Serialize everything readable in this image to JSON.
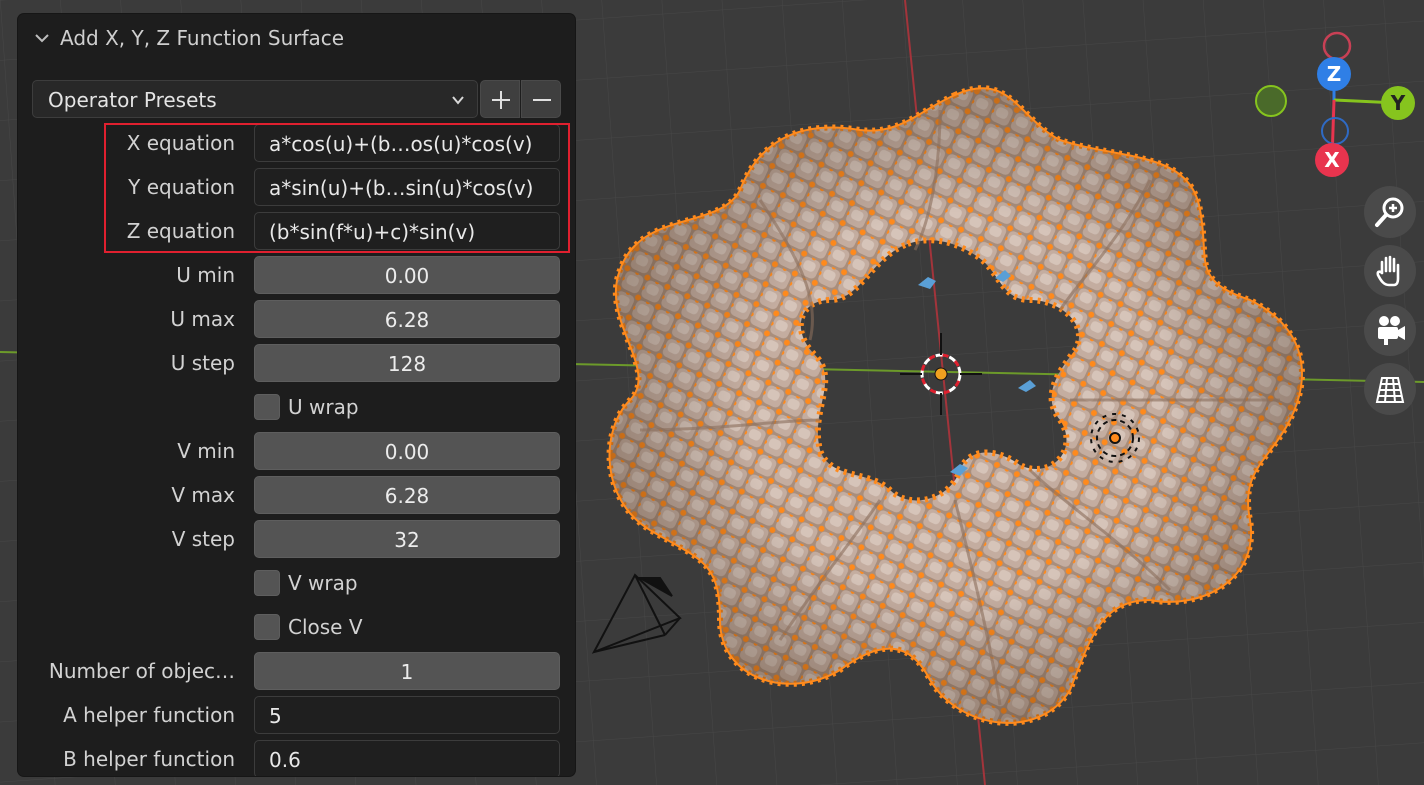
{
  "panel": {
    "title": "Add X, Y, Z Function Surface",
    "presets_label": "Operator Presets",
    "x_equation": {
      "label": "X equation",
      "value": "a*cos(u)+(b…os(u)*cos(v)"
    },
    "y_equation": {
      "label": "Y equation",
      "value": "a*sin(u)+(b…sin(u)*cos(v)"
    },
    "z_equation": {
      "label": "Z equation",
      "value": "(b*sin(f*u)+c)*sin(v)"
    },
    "u_min": {
      "label": "U min",
      "value": "0.00"
    },
    "u_max": {
      "label": "U max",
      "value": "6.28"
    },
    "u_step": {
      "label": "U step",
      "value": "128"
    },
    "u_wrap": {
      "label": "U wrap"
    },
    "v_min": {
      "label": "V min",
      "value": "0.00"
    },
    "v_max": {
      "label": "V max",
      "value": "6.28"
    },
    "v_step": {
      "label": "V step",
      "value": "32"
    },
    "v_wrap": {
      "label": "V wrap"
    },
    "close_v": {
      "label": "Close V"
    },
    "num_objects": {
      "label": "Number of objec…",
      "value": "1"
    },
    "a_helper": {
      "label": "A helper function",
      "value": "5"
    },
    "b_helper": {
      "label": "B helper function",
      "value": "0.6"
    }
  },
  "gizmo": {
    "z": "Z",
    "y": "Y",
    "x": "X"
  },
  "colors": {
    "accent_orange": "#ff8a1c",
    "axis_x": "#e8344e",
    "axis_y": "#86c41e",
    "axis_z": "#2f7fe6",
    "panel_bg": "#1d1d1d",
    "highlight": "#e0202f"
  },
  "icons": [
    "chevron-down-icon",
    "plus-icon",
    "minus-icon",
    "zoom-icon",
    "hand-icon",
    "camera-icon",
    "grid-icon"
  ]
}
